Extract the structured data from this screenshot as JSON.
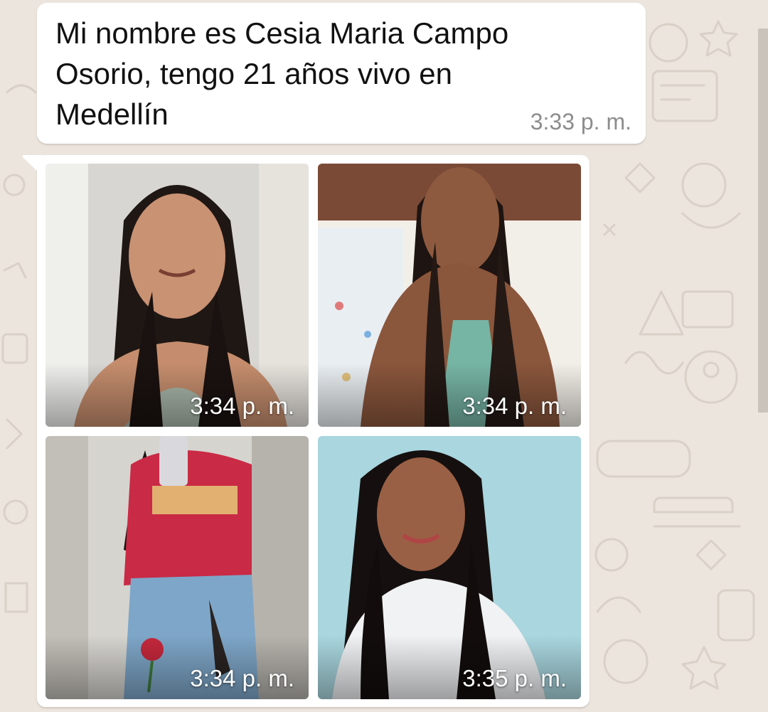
{
  "chat": {
    "background_color": "#ece5dd",
    "bubble_color": "#ffffff",
    "text_message": {
      "text": "Mi nombre es Cesia Maria Campo\nOsorio, tengo 21 años vivo en\nMedellín",
      "time": "3:33 p. m."
    },
    "photos": [
      {
        "time": "3:34 p. m.",
        "subject": "selfie-woman-long-dark-hair"
      },
      {
        "time": "3:34 p. m.",
        "subject": "selfie-woman-green-top"
      },
      {
        "time": "3:34 p. m.",
        "subject": "mirror-selfie-red-shirt-jeans"
      },
      {
        "time": "3:35 p. m.",
        "subject": "selfie-woman-white-top"
      }
    ]
  }
}
